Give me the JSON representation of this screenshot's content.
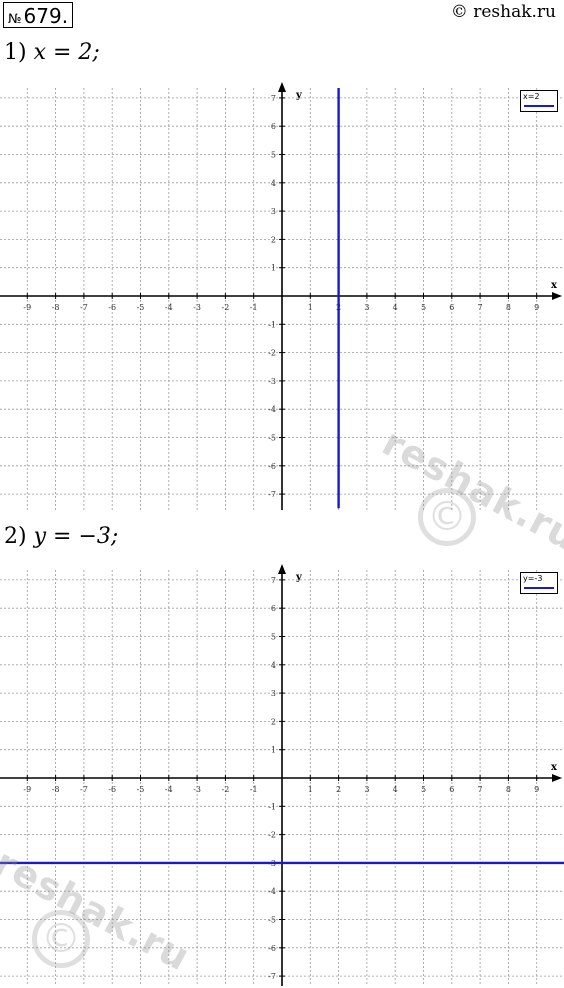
{
  "header": {
    "problem_number_prefix": "№",
    "problem_number": "679.",
    "site": "© reshak.ru"
  },
  "parts": [
    {
      "index": "1)",
      "equation": "x = 2;",
      "legend": "x=2",
      "color": "#1a1acc"
    },
    {
      "index": "2)",
      "equation": "y = −3;",
      "legend": "y=-3",
      "color": "#1a1acc"
    }
  ],
  "watermark": {
    "text": "reshak.ru",
    "symbol": "©"
  },
  "chart_data": [
    {
      "type": "line",
      "xlabel": "x",
      "ylabel": "y",
      "xlim": [
        -10,
        10
      ],
      "ylim": [
        -7.5,
        7.5
      ],
      "x_ticks": [
        -9,
        -8,
        -7,
        -6,
        -5,
        -4,
        -3,
        -2,
        -1,
        1,
        2,
        3,
        4,
        5,
        6,
        7,
        8,
        9
      ],
      "y_ticks": [
        -7,
        -6,
        -5,
        -4,
        -3,
        -2,
        -1,
        1,
        2,
        3,
        4,
        5,
        6,
        7
      ],
      "grid": true,
      "legend_position": "top-right",
      "series": [
        {
          "name": "x=2",
          "x": [
            2,
            2
          ],
          "y": [
            -7.5,
            7.5
          ],
          "color": "#1a1acc"
        }
      ]
    },
    {
      "type": "line",
      "xlabel": "x",
      "ylabel": "y",
      "xlim": [
        -10,
        10
      ],
      "ylim": [
        -7.5,
        7.5
      ],
      "x_ticks": [
        -9,
        -8,
        -7,
        -6,
        -5,
        -4,
        -3,
        -2,
        -1,
        1,
        2,
        3,
        4,
        5,
        6,
        7,
        8,
        9
      ],
      "y_ticks": [
        -7,
        -6,
        -5,
        -4,
        -3,
        -2,
        -1,
        1,
        2,
        3,
        4,
        5,
        6,
        7
      ],
      "grid": true,
      "legend_position": "top-right",
      "series": [
        {
          "name": "y=-3",
          "x": [
            -10,
            10
          ],
          "y": [
            -3,
            -3
          ],
          "color": "#1a1acc"
        }
      ]
    }
  ]
}
